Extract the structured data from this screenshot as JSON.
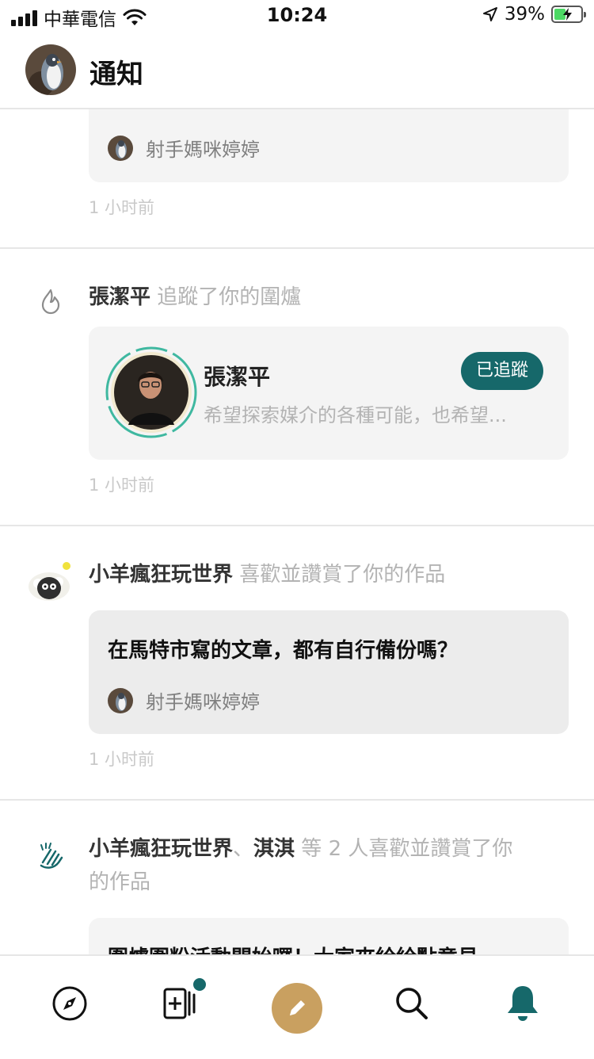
{
  "status_bar": {
    "carrier": "中華電信",
    "time": "10:24",
    "battery": "39%"
  },
  "header": {
    "title": "通知"
  },
  "notifications": [
    {
      "author": "射手媽咪婷婷",
      "time": "1 小时前"
    },
    {
      "actor": "張潔平",
      "action": "追蹤了你的圍爐",
      "profile": {
        "name": "張潔平",
        "bio": "希望探索媒介的各種可能，也希望...",
        "follow_label": "已追蹤"
      },
      "time": "1 小时前"
    },
    {
      "actor": "小羊瘋狂玩世界",
      "action": "喜歡並讚賞了你的作品",
      "article_title": "在馬特市寫的文章，都有自行備份嗎？",
      "author": "射手媽咪婷婷",
      "time": "1 小时前"
    },
    {
      "actor1": "小羊瘋狂玩世界",
      "separator": "、",
      "actor2": "淇淇",
      "action_line1": " 等 2 人喜歡並讚賞了你",
      "action_line2": "的作品",
      "article_title": "圍爐圍粉活動開始囉！大家來給給點意見"
    }
  ],
  "colors": {
    "accent": "#16686a",
    "write_button": "#c9a060",
    "muted_text": "#b3b3b3"
  },
  "bottom_nav": [
    {
      "name": "discover",
      "icon": "compass-icon"
    },
    {
      "name": "following",
      "icon": "add-collection-icon",
      "has_badge": true
    },
    {
      "name": "write",
      "icon": "pencil-icon"
    },
    {
      "name": "search",
      "icon": "search-icon"
    },
    {
      "name": "notifications",
      "icon": "bell-icon",
      "active": true
    }
  ]
}
